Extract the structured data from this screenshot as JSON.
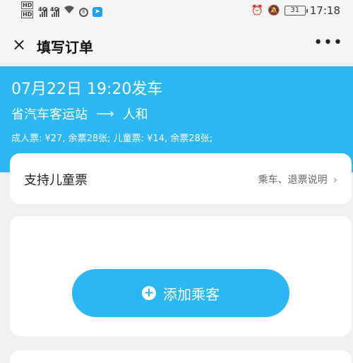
{
  "status_bar": {
    "time": "17:18",
    "battery": "31",
    "left_badges": [
      "HD",
      "HD"
    ],
    "net_labels": [
      "4G",
      "4G"
    ],
    "icons": [
      "signal-icon",
      "wifi-icon",
      "sync-icon",
      "app-icon",
      "alarm-icon",
      "mute-icon",
      "battery-icon"
    ]
  },
  "title_bar": {
    "close_glyph": "×",
    "title": "填写订单",
    "more_glyph": "•••"
  },
  "trip": {
    "depart_time": "07月22日 19:20发车",
    "from": "省汽车客运站",
    "arrow": "⟶",
    "to": "人和",
    "prices": "成人票: ¥27, 余票28张; 儿童票: ¥14, 余票28张;"
  },
  "child_card": {
    "label": "支持儿童票",
    "rules_link": "乘车、退票说明",
    "chevron": "›"
  },
  "passenger_card": {
    "add_label": "添加乘客",
    "plus_glyph": "+"
  },
  "colors": {
    "accent": "#2ab7f3",
    "background": "#f1f1f1"
  }
}
